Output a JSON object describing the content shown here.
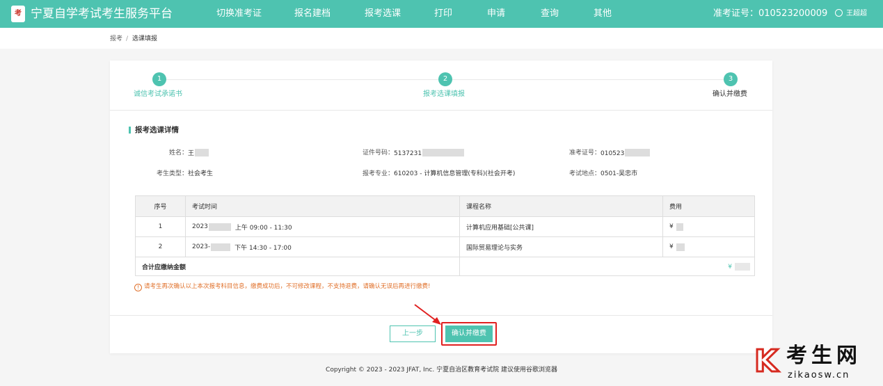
{
  "header": {
    "logo_text": "考",
    "title": "宁夏自学考试考生服务平台",
    "nav": [
      "切换准考证",
      "报名建档",
      "报考选课",
      "打印",
      "申请",
      "查询",
      "其他"
    ],
    "ticket_label": "准考证号：010523200009",
    "user_name": "王超超"
  },
  "breadcrumb": {
    "root": "报考",
    "sep": "/",
    "current": "选课填报"
  },
  "steps": [
    {
      "num": "1",
      "label": "诚信考试承诺书"
    },
    {
      "num": "2",
      "label": "报考选课填报"
    },
    {
      "num": "3",
      "label": "确认并缴费"
    }
  ],
  "section_title": "报考选课详情",
  "info": {
    "name_label": "姓名：",
    "name_value": "王",
    "id_label": "证件号码：",
    "id_value": "5137231",
    "ticket_label": "准考证号：",
    "ticket_value": "010523",
    "type_label": "考生类型：",
    "type_value": "社会考生",
    "major_label": "报考专业：",
    "major_value": "610203 - 计算机信息管理(专科)(社会开考)",
    "site_label": "考试地点：",
    "site_value": "0501-吴忠市"
  },
  "table": {
    "headers": [
      "序号",
      "考试时间",
      "课程名称",
      "费用"
    ],
    "rows": [
      {
        "no": "1",
        "date": "2023",
        "time": "上午 09:00 - 11:30",
        "course": "计算机应用基础[公共课]",
        "fee": "¥"
      },
      {
        "no": "2",
        "date": "2023-",
        "time": "下午 14:30 - 17:00",
        "course": "国际贸易理论与实务",
        "fee": "¥"
      }
    ],
    "total_label": "合计应缴纳金额",
    "total_value": "¥"
  },
  "notice": "请考生再次确认以上本次报考科目信息，缴费成功后，不可修改课程，不支持退费，请确认无误后再进行缴费!",
  "buttons": {
    "prev": "上一步",
    "confirm": "确认并缴费"
  },
  "footer": "Copyright © 2023 - 2023 JFAT, Inc. 宁夏自治区教育考试院 建议使用谷歌浏览器",
  "watermark": {
    "cn": "考生网",
    "url": "zikaosw.cn"
  },
  "colors": {
    "primary": "#4ec3b0",
    "warning": "#e0702a",
    "highlight": "#e02020"
  }
}
